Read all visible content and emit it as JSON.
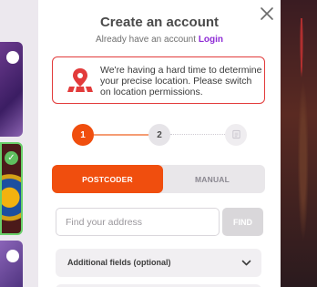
{
  "modal": {
    "title": "Create an account",
    "signin_prompt": "Already have an account",
    "login_link": "Login",
    "alert": {
      "icon": "location-pin-icon",
      "message": "We're having a hard time to determine your precise location. Please switch on location permissions."
    },
    "stepper": {
      "steps": [
        "1",
        "2"
      ],
      "current_step": 1,
      "final_step_icon": "document-icon"
    },
    "tabs": [
      {
        "label": "POSTCODER",
        "active": true
      },
      {
        "label": "MANUAL",
        "active": false
      }
    ],
    "address_search": {
      "placeholder": "Find your address",
      "value": "",
      "button_label": "FIND"
    },
    "additional_fields": {
      "label": "Additional fields (optional)",
      "icon": "chevron-down-icon"
    },
    "close_icon": "close-icon"
  },
  "colors": {
    "accent": "#f04e0e",
    "link": "#8e2bd6",
    "alert_border": "#e23b3b",
    "success": "#5fbf5f"
  }
}
